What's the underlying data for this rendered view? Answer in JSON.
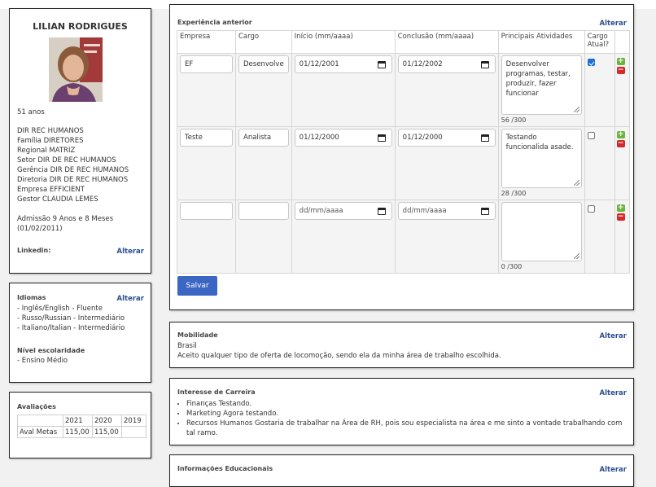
{
  "profile": {
    "name": "LILIAN RODRIGUES",
    "age": "51 anos",
    "details": [
      "DIR REC HUMANOS",
      "Família DIRETORES",
      "Regional MATRIZ",
      "Setor DIR DE REC HUMANOS",
      "Gerência DIR DE REC HUMANOS",
      "Diretoria DIR DE REC HUMANOS",
      "Empresa EFFICIENT",
      "Gestor CLAUDIA LEMES"
    ],
    "admission_line1": "Admissão 9 Anos e 8 Meses",
    "admission_line2": "(01/02/2011)",
    "linkedin_label": "Linkedin:",
    "linkedin_action": "Alterar"
  },
  "languages": {
    "title": "Idiomas",
    "action": "Alterar",
    "items": [
      "- Inglês/English - Fluente",
      "- Russo/Russian - Intermediário",
      "- Italiano/Italian - Intermediário"
    ],
    "education_title": "Nível escolaridade",
    "education_value": "- Ensino Médio"
  },
  "evaluations": {
    "title": "Avaliações",
    "years": [
      "2021",
      "2020",
      "2019"
    ],
    "row_label": "Aval Metas",
    "values": [
      "115,00",
      "115,00",
      ""
    ]
  },
  "experience": {
    "title": "Experiência anterior",
    "action": "Alterar",
    "headers": {
      "company": "Empresa",
      "role": "Cargo",
      "start": "Início (mm/aaaa)",
      "end": "Conclusão (mm/aaaa)",
      "activities": "Principais Atividades",
      "current_line1": "Cargo",
      "current_line2": "Atual?"
    },
    "rows": [
      {
        "company": "EF",
        "role": "Desenvolve",
        "start": "01/12/2001",
        "end": "01/12/2002",
        "activities": "Desenvolver programas, testar, produzir, fazer funcionar",
        "count": "56 /300",
        "current": true
      },
      {
        "company": "Teste",
        "role": "Analista",
        "start": "01/12/2000",
        "end": "01/12/2000",
        "activities": "Testando funcionalida asade.",
        "count": "28 /300",
        "current": false
      },
      {
        "company": "",
        "role": "",
        "start": "dd/mm/aaaa",
        "end": "dd/mm/aaaa",
        "activities": "",
        "count": "0 /300",
        "current": false
      }
    ],
    "add_symbol": "+",
    "remove_symbol": "−",
    "save_label": "Salvar"
  },
  "mobility": {
    "title": "Mobilidade",
    "action": "Alterar",
    "line1": "Brasil",
    "line2": "Aceito qualquer tipo de oferta de locomoção, sendo ela da minha área de trabalho escolhida."
  },
  "career": {
    "title": "Interesse de Carreira",
    "action": "Alterar",
    "items": [
      "Finanças Testando.",
      "Marketing Agora testando.",
      "Recursos Humanos Gostaria de trabalhar na Área de RH, pois sou especialista na área e me sinto a vontade trabalhando com tal ramo."
    ]
  },
  "education": {
    "title": "Informações Educacionais",
    "action": "Alterar"
  },
  "colors": {
    "accent": "#3b66c4",
    "link": "#2c4f8f",
    "add": "#6cb33f",
    "remove": "#d42a2a"
  },
  "icons": [
    "calendar-icon",
    "plus-icon",
    "minus-icon",
    "checkbox-icon"
  ]
}
